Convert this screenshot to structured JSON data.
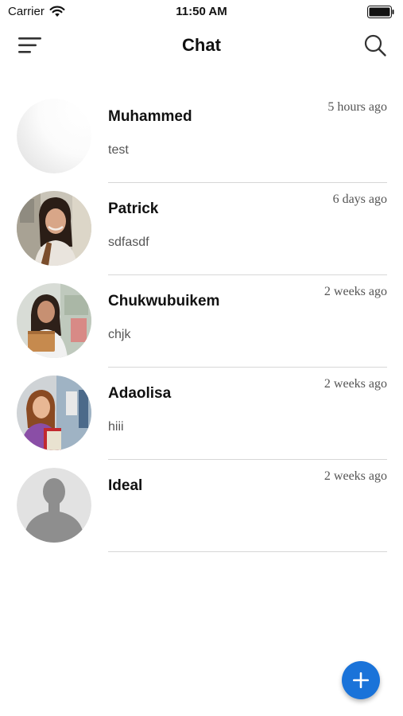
{
  "status_bar": {
    "carrier": "Carrier",
    "time": "11:50 AM",
    "wifi_icon": "wifi-icon",
    "battery_icon": "battery-icon"
  },
  "header": {
    "title": "Chat",
    "menu_icon": "menu-icon",
    "search_icon": "search-icon"
  },
  "conversations": [
    {
      "name": "Muhammed",
      "preview": "test",
      "time": "5 hours ago",
      "avatar": "blank-avatar"
    },
    {
      "name": "Patrick",
      "preview": "sdfasdf",
      "time": "6 days ago",
      "avatar": "photo-woman-dark-hair"
    },
    {
      "name": "Chukwubuikem",
      "preview": "chjk",
      "time": "2 weeks ago",
      "avatar": "photo-woman-student-notebook"
    },
    {
      "name": "Adaolisa",
      "preview": "hiii",
      "time": "2 weeks ago",
      "avatar": "photo-woman-student-books"
    },
    {
      "name": "Ideal",
      "preview": "",
      "time": "2 weeks ago",
      "avatar": "default-silhouette-avatar"
    }
  ],
  "fab": {
    "icon": "plus-icon"
  },
  "colors": {
    "accent": "#1a73d9",
    "separator": "#d7d7d7",
    "secondary_text": "#555555"
  }
}
